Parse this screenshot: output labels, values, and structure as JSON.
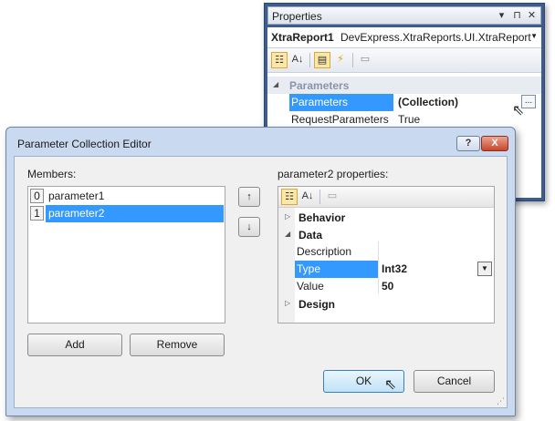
{
  "properties": {
    "title": "Properties",
    "object_name": "XtraReport1",
    "object_type": "DevExpress.XtraReports.UI.XtraReport",
    "category": "Parameters",
    "rows": [
      {
        "name": "Parameters",
        "value": "(Collection)",
        "ellipsis": "..."
      },
      {
        "name": "RequestParameters",
        "value": "True"
      }
    ]
  },
  "dialog": {
    "title": "Parameter Collection Editor",
    "help_label": "?",
    "close_label": "X",
    "members_label": "Members:",
    "members": [
      {
        "index": "0",
        "name": "parameter1"
      },
      {
        "index": "1",
        "name": "parameter2"
      }
    ],
    "selected_member": "parameter2",
    "properties_label": "parameter2 properties:",
    "categories": {
      "behavior": "Behavior",
      "data": "Data",
      "design": "Design"
    },
    "data_rows": [
      {
        "name": "Description",
        "value": ""
      },
      {
        "name": "Type",
        "value": "Int32"
      },
      {
        "name": "Value",
        "value": "50"
      }
    ],
    "buttons": {
      "add": "Add",
      "remove": "Remove",
      "ok": "OK",
      "cancel": "Cancel",
      "up": "↑",
      "down": "↓"
    }
  },
  "colors": {
    "selection": "#3399ff",
    "window_border": "#3d5c8f",
    "dialog_frame": "#c9daf0"
  }
}
